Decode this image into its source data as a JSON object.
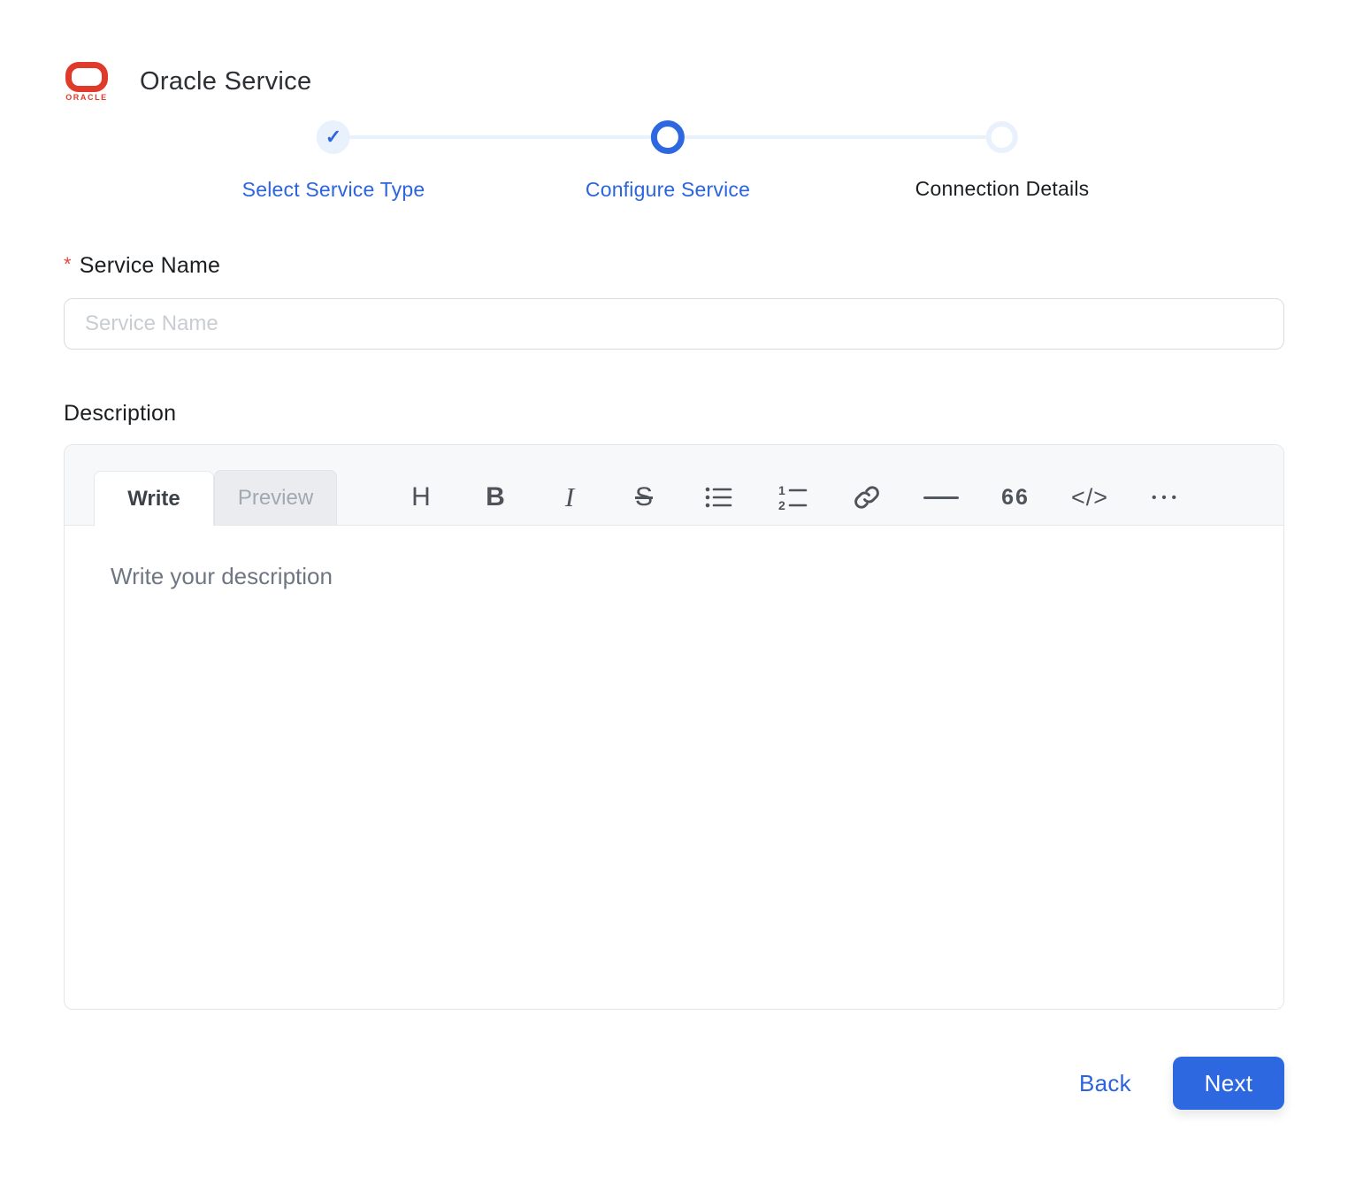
{
  "header": {
    "app_title": "Oracle Service",
    "logo_text": "ORACLE"
  },
  "stepper": {
    "check_glyph": "✓",
    "steps": [
      {
        "label": "Select Service Type",
        "state": "completed"
      },
      {
        "label": "Configure Service",
        "state": "active"
      },
      {
        "label": "Connection Details",
        "state": "upcoming"
      }
    ]
  },
  "form": {
    "service_name": {
      "label": "Service Name",
      "required_marker": "*",
      "placeholder": "Service Name",
      "value": ""
    },
    "description": {
      "label": "Description",
      "editor": {
        "tabs": [
          {
            "label": "Write",
            "active": true
          },
          {
            "label": "Preview",
            "active": false
          }
        ],
        "toolbar": [
          {
            "name": "heading-icon",
            "glyph": "H"
          },
          {
            "name": "bold-icon",
            "glyph": "B"
          },
          {
            "name": "italic-icon",
            "glyph": "I"
          },
          {
            "name": "strikethrough-icon",
            "glyph": "S"
          },
          {
            "name": "bullet-list-icon",
            "glyph": ""
          },
          {
            "name": "numbered-list-icon",
            "glyph": ""
          },
          {
            "name": "link-icon",
            "glyph": ""
          },
          {
            "name": "horizontal-rule-icon",
            "glyph": "—"
          },
          {
            "name": "quote-icon",
            "glyph": "66"
          },
          {
            "name": "code-icon",
            "glyph": "</>"
          },
          {
            "name": "more-icon",
            "glyph": "•••"
          }
        ],
        "placeholder": "Write your description",
        "value": ""
      }
    }
  },
  "footer": {
    "back_label": "Back",
    "next_label": "Next"
  },
  "colors": {
    "primary_blue": "#2d68e0",
    "step_light_blue": "#e8f1fc",
    "oracle_red": "#e03a2a",
    "required_red": "#e5483d"
  }
}
